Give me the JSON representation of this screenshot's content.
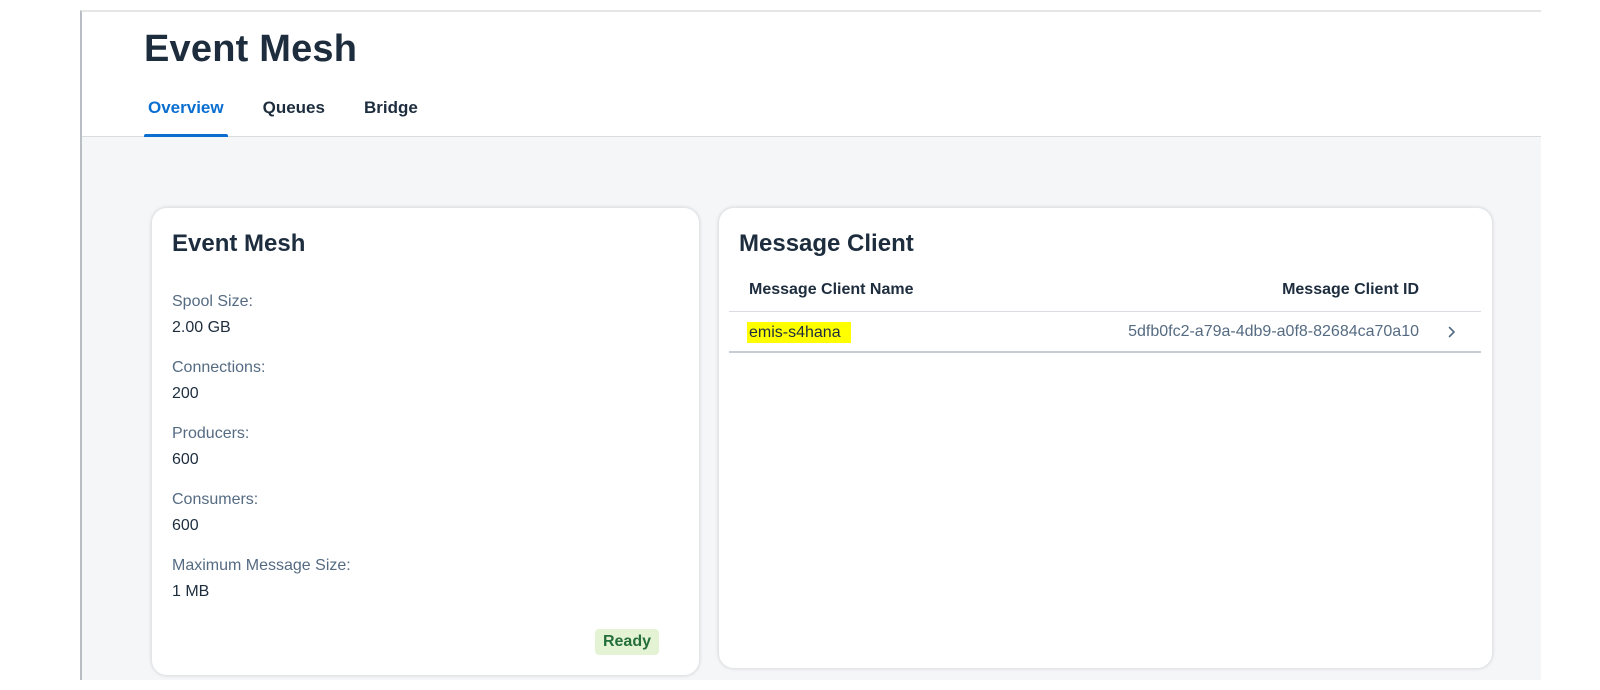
{
  "header": {
    "title": "Event Mesh",
    "tabs": [
      {
        "label": "Overview",
        "active": true
      },
      {
        "label": "Queues",
        "active": false
      },
      {
        "label": "Bridge",
        "active": false
      }
    ]
  },
  "event_mesh_card": {
    "title": "Event Mesh",
    "properties": [
      {
        "label": "Spool Size:",
        "value": "2.00 GB"
      },
      {
        "label": "Connections:",
        "value": "200"
      },
      {
        "label": "Producers:",
        "value": "600"
      },
      {
        "label": "Consumers:",
        "value": "600"
      },
      {
        "label": "Maximum Message Size:",
        "value": "1 MB"
      }
    ],
    "status": "Ready"
  },
  "message_client_card": {
    "title": "Message Client",
    "columns": [
      "Message Client Name",
      "Message Client ID"
    ],
    "rows": [
      {
        "name": "emis-s4hana",
        "id": "5dfb0fc2-a79a-4db9-a0f8-82684ca70a10"
      }
    ]
  },
  "colors": {
    "accent": "#0a6ed1",
    "highlight": "#ffff00",
    "status_positive_bg": "#e4f3d4",
    "status_positive_text": "#256f3a"
  },
  "icons": {
    "row_navigation": "chevron-right-icon"
  }
}
